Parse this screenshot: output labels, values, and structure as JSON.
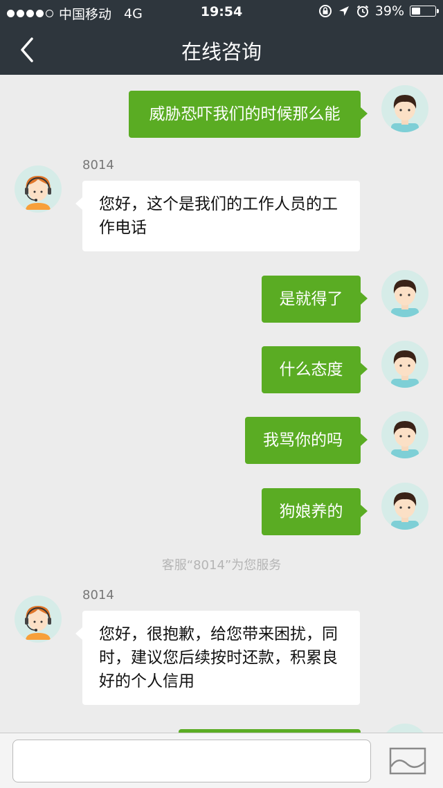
{
  "status_bar": {
    "carrier": "中国移动",
    "network": "4G",
    "time": "19:54",
    "battery": "39%",
    "battery_level": 0.39,
    "icons": [
      "signal-dots-icon",
      "rotation-lock-icon",
      "location-arrow-icon",
      "alarm-icon",
      "battery-icon"
    ]
  },
  "header": {
    "title": "在线咨询",
    "back_icon": "chevron-left-icon"
  },
  "messages": [
    {
      "side": "out",
      "text": "威胁恐吓我们的时候那么能"
    },
    {
      "side": "in",
      "sender": "8014",
      "text": "您好，这个是我们的工作人员的工作电话"
    },
    {
      "side": "out",
      "text": "是就得了"
    },
    {
      "side": "out",
      "text": "什么态度"
    },
    {
      "side": "out",
      "text": "我骂你的吗"
    },
    {
      "side": "out",
      "text": "狗娘养的"
    },
    {
      "notice": "客服“8014”为您服务"
    },
    {
      "side": "in",
      "sender": "8014",
      "text": "您好，很抱歉，给您带来困扰，同时，建议您后续按时还款，积累良好的个人信用"
    },
    {
      "side": "out",
      "text": ""
    }
  ],
  "input_bar": {
    "placeholder": "",
    "image_button_icon": "image-icon"
  },
  "colors": {
    "header_bg": "#2e363d",
    "chat_bg": "#ececec",
    "outgoing_bubble": "#5aac23",
    "incoming_bubble": "#ffffff",
    "avatar_bg": "#d6ece8"
  }
}
